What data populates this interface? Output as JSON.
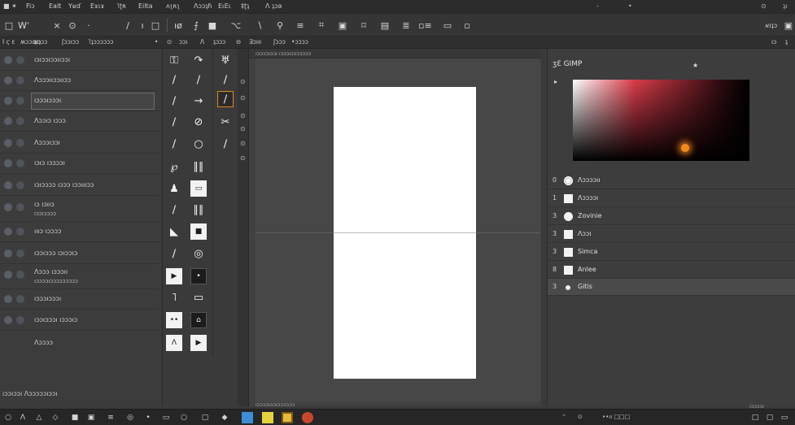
{
  "menubar": {
    "items": [
      "■ ✶",
      "Fiɔ",
      "Ealt",
      "Yʁɗ",
      "Eɤιɤ",
      "˥ʈʀ",
      "Eilta",
      "ʌʅʀʅ",
      "Ʌɔɔʇɦ",
      "EɩEɩ",
      "‡ʈʇ",
      "Ʌ ʇɔǝ"
    ],
    "window_controls": [
      "-",
      "•"
    ],
    "right_items": [
      "⊙",
      "ʇı"
    ]
  },
  "toolbar": {
    "icons": [
      "□",
      "Wˈ",
      "×",
      "⊙",
      "·",
      "∕",
      "ı",
      "□",
      "·",
      "ıø",
      "⨍",
      "■",
      "⌥",
      "∖",
      "⚲",
      "≡",
      "⌗",
      "▣",
      "⌑",
      "▤",
      "≣",
      "▫≡",
      "▭",
      "▫"
    ],
    "right_text": "אıʇɔ",
    "right_icon": "▣"
  },
  "options_bar": {
    "items": [
      "Ι ϛ ε",
      "ʍɔɔǝıɔ",
      "ʇıʇɔɔ",
      "ʃɔɔıɔɔ",
      "˥ʇɔɔɔɔɔɔ",
      "•",
      "⊙",
      "ɔɔı",
      "Ʌ",
      "ʇɔɔɔ",
      "⊖",
      "∃ɔııı",
      "ʃɔɔɔ",
      "•ɔɔɔɔ"
    ],
    "right_items": [
      "ıɔ",
      "ʇ"
    ]
  },
  "layers": {
    "rows": [
      {
        "name": "ıɔıɔɔıɔɔııɔɔı",
        "sub": ""
      },
      {
        "name": "Ʌɔɔɔııɔɔııɔɔ",
        "sub": ""
      },
      {
        "name": "ıɔɔɔıɔɔɔı",
        "sub": ""
      },
      {
        "name": "Ʌɔɔıɔ ıɔɔɔ",
        "sub": ""
      },
      {
        "name": "Ʌɔɔɔıɔɔı",
        "sub": ""
      },
      {
        "name": "ıɔıɔ ıɔɔɔɔı",
        "sub": ""
      },
      {
        "name": "ıɔıɔɔɔɔ ıɔɔɔ ıɔɔıııɔɔ",
        "sub": ""
      },
      {
        "name": "ıɔ ıɔııɔ",
        "sub": "ıɔɔıɔɔɔɔ"
      },
      {
        "name": "ıııɔ ıɔɔɔɔ",
        "sub": ""
      },
      {
        "name": "ıɔɔıɔɔɔ ıɔıɔɔıɔ",
        "sub": ""
      },
      {
        "name": "Ʌɔɔɔ ıɔɔɔıı",
        "sub": "ıɔɔɔɔıɔɔɔɔɔɔɔɔɔ"
      },
      {
        "name": "ıɔɔɔıɔɔɔı",
        "sub": ""
      },
      {
        "name": "ıɔɔıɔɔɔı ıɔɔɔıɔ",
        "sub": ""
      },
      {
        "name": "Ʌɔɔɔɔ",
        "sub": ""
      }
    ],
    "footer": "ıɔɔıɔɔı Ʌɔɔɔɔɔıɔɔı"
  },
  "toolbox": {
    "icons": [
      "⚿",
      "↷",
      "∕",
      "∕",
      "∕",
      "♅",
      "∕",
      "→",
      "∕",
      "∕",
      "⊘",
      "✂",
      "∕",
      "○",
      "∕",
      "℘",
      "∥∥",
      "♟",
      "▭",
      "∕",
      "∥∥",
      "◣",
      "■",
      "∕",
      "◎",
      "▶",
      "•",
      "˥",
      "▭",
      "••",
      "⌂",
      "Ʌ",
      "▶"
    ],
    "active_index": 8
  },
  "canvas": {
    "ruler_text": "ıɔɔɔɔıɔɔı ıɔɔɔıɔɔɔɔɔɔɔ",
    "status_left": "ıɔɔɔɔıɔɔıɔɔɔɔɔɔ"
  },
  "color_panel": {
    "title": "ʒƐ GIMP",
    "star": "★",
    "arrow": "▸",
    "picker_colors": {
      "start": "#ffffff",
      "hue": "#d93c4a",
      "dark": "#000000",
      "marker": "#f08a1c"
    },
    "rows": [
      {
        "num": "0",
        "swatch": "globe",
        "name": "Ʌɔɔɔɔıı"
      },
      {
        "num": "1",
        "swatch": "square",
        "name": "Ʌɔɔɔɔı"
      },
      {
        "num": "3",
        "swatch": "circle",
        "name": "Zovinie"
      },
      {
        "num": "3",
        "swatch": "square",
        "name": "Ʌɔɔı"
      },
      {
        "num": "3",
        "swatch": "square",
        "name": "Simca"
      },
      {
        "num": "8",
        "swatch": "square",
        "name": "Anlee"
      },
      {
        "num": "3",
        "swatch": "dot",
        "name": "Gitis"
      }
    ],
    "footer": "ıɔɔɔɔı"
  },
  "taskbar": {
    "left_icons": [
      "○",
      "Ʌ",
      "△",
      "◇",
      "■",
      "▣",
      "≡",
      "◎",
      "•",
      "▭",
      "○",
      "▢",
      "◆"
    ],
    "tray_text": "••ıı □□□",
    "right_icons": [
      "□",
      "▢",
      "▭"
    ]
  }
}
